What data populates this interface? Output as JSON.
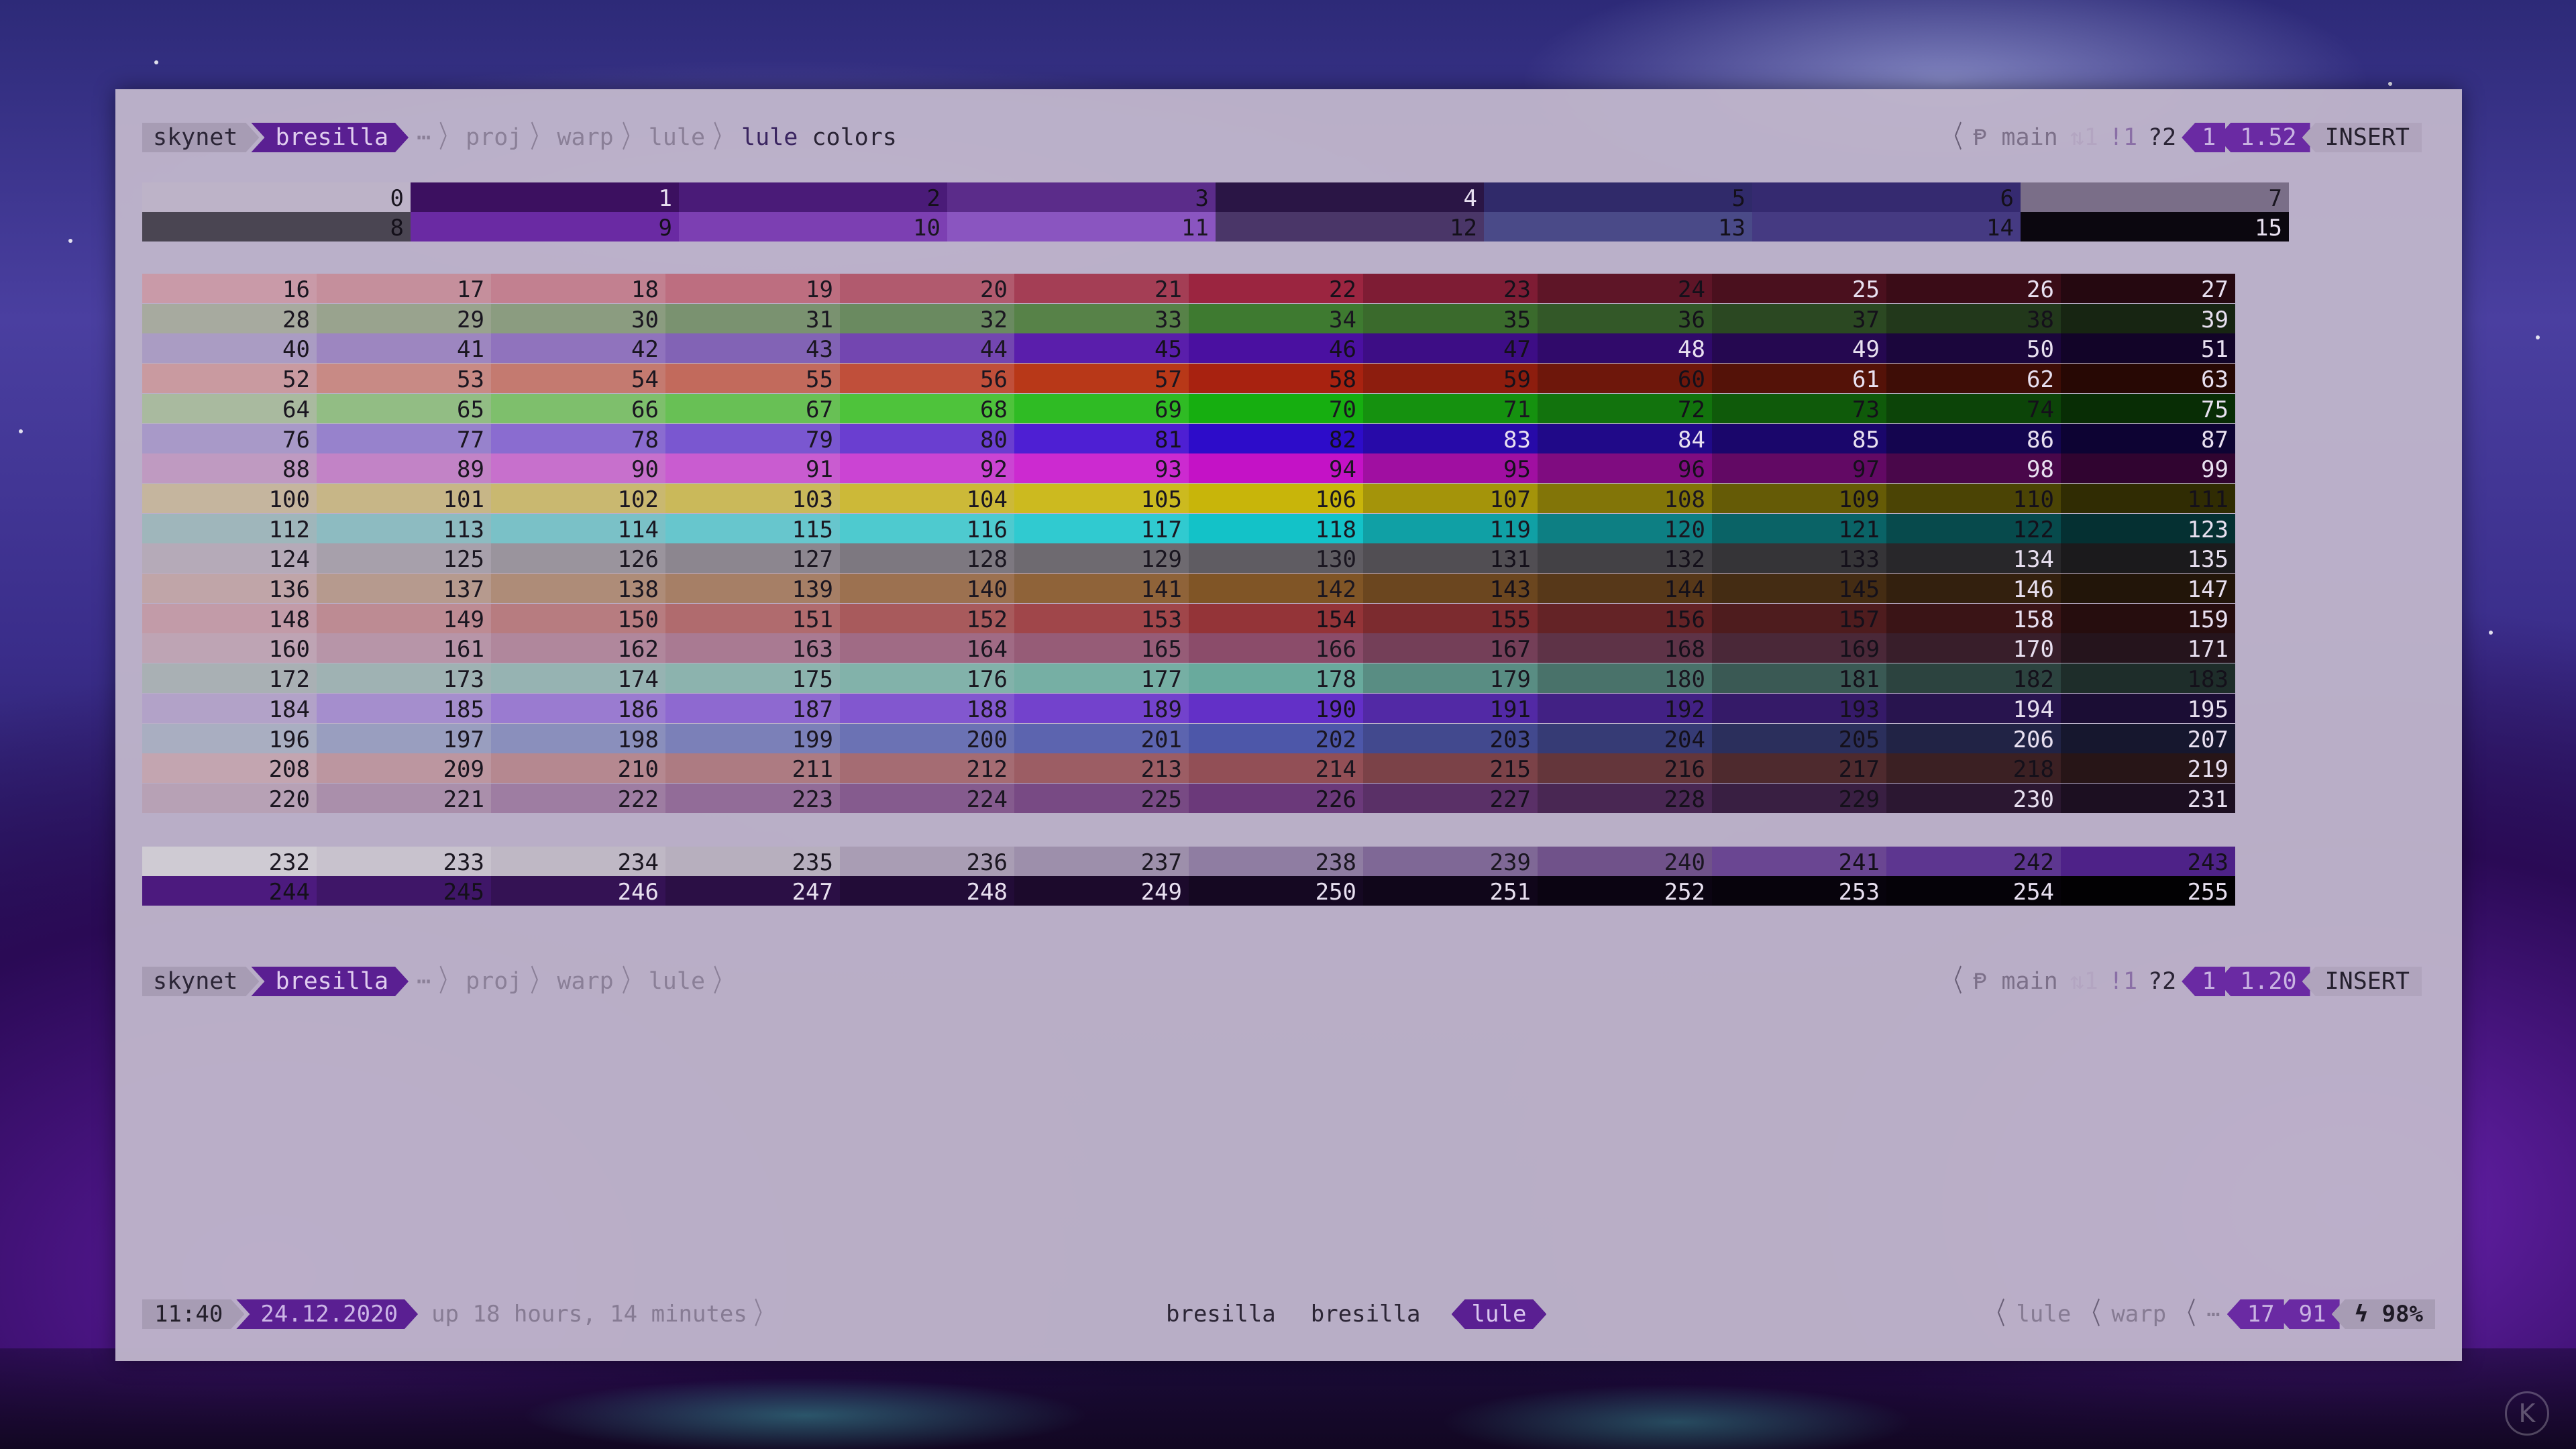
{
  "prompt_top": {
    "host": "skynet",
    "user": "bresilla",
    "ellipsis": "⋯",
    "path": [
      "proj",
      "warp",
      "lule"
    ],
    "command": "lule",
    "command_arg": "colors",
    "branch_icon": "Ᵽ",
    "branch": "main",
    "sync": "⇅1",
    "stash": "!1",
    "untracked": "?2",
    "jobs": "1",
    "duration": "1.52",
    "mode": "INSERT"
  },
  "prompt_bottom": {
    "host": "skynet",
    "user": "bresilla",
    "ellipsis": "⋯",
    "path": [
      "proj",
      "warp",
      "lule"
    ],
    "branch_icon": "Ᵽ",
    "branch": "main",
    "sync": "⇅1",
    "stash": "!1",
    "untracked": "?2",
    "jobs": "1",
    "duration": "1.20",
    "mode": "INSERT"
  },
  "palette": {
    "base_colors": [
      "#bdb3c8",
      "#3c1060",
      "#4a1b78",
      "#5b2c8a",
      "#2a1545",
      "#302a6a",
      "#352a70",
      "#7a6e88",
      "#4a4552",
      "#6a2aa3",
      "#7c3fb2",
      "#8a55c0",
      "#4a3668",
      "#4a4a88",
      "#453a82",
      "#0b070f"
    ],
    "cube_rows": [
      [
        "#c99aa8",
        "#c58f9c",
        "#c28090",
        "#bd6e80",
        "#b15a6e",
        "#a43e55",
        "#9b2540",
        "#7e1c34",
        "#5e1527",
        "#4a101e",
        "#3a0c17",
        "#250810"
      ],
      [
        "#a7aa9f",
        "#99a38e",
        "#8b9c80",
        "#7a9270",
        "#6a8a60",
        "#578248",
        "#3e7a30",
        "#3a6a2c",
        "#335828",
        "#2b4822",
        "#22381b",
        "#172512"
      ],
      [
        "#aa9cc3",
        "#9d86c0",
        "#9073bd",
        "#8263b5",
        "#7346b0",
        "#5a1eab",
        "#4a10a0",
        "#3d0d85",
        "#300a6a",
        "#250850",
        "#1b063c",
        "#120428"
      ],
      [
        "#c99aa0",
        "#c88a85",
        "#c47a70",
        "#c26a5c",
        "#c04f3a",
        "#b83818",
        "#a82210",
        "#8d1d0e",
        "#6e170b",
        "#541208",
        "#3e0d06",
        "#270804"
      ],
      [
        "#a9ba9f",
        "#92bd84",
        "#7ebf6c",
        "#68c055",
        "#4ec33b",
        "#2fbb24",
        "#16ae10",
        "#15910f",
        "#12730d",
        "#0f5a0a",
        "#0c4408",
        "#082d05"
      ],
      [
        "#a899c8",
        "#9782cc",
        "#8a6cd0",
        "#7a57d0",
        "#6a3ed0",
        "#4e1fd3",
        "#2d0cc9",
        "#270aa8",
        "#200988",
        "#1a066b",
        "#14054f",
        "#0d0333"
      ],
      [
        "#bf9ac1",
        "#c283c6",
        "#c770cc",
        "#c95cd0",
        "#cb44d3",
        "#cc2ad0",
        "#c412c6",
        "#a00fa1",
        "#7f0c80",
        "#620964",
        "#49074a",
        "#300430"
      ],
      [
        "#c5b59e",
        "#c7b687",
        "#c9b870",
        "#cab95a",
        "#ccb938",
        "#ccba1f",
        "#c8b50a",
        "#a4940a",
        "#827508",
        "#655b06",
        "#4b4405",
        "#302c03"
      ],
      [
        "#9fb6bb",
        "#8dbbc1",
        "#7ac1c7",
        "#67c6cd",
        "#4ecacf",
        "#30cad0",
        "#13c2c8",
        "#10a0a5",
        "#0d7f83",
        "#0a6366",
        "#074a4c",
        "#053032"
      ],
      [
        "#b5aab8",
        "#a7a0ab",
        "#9a949d",
        "#8c868f",
        "#7d7880",
        "#6e6a70",
        "#5f5c62",
        "#514e53",
        "#434145",
        "#353437",
        "#28272a",
        "#1b1a1c"
      ],
      [
        "#c0a5a8",
        "#b69a8e",
        "#ae8c78",
        "#a67f66",
        "#9c7150",
        "#8f6339",
        "#805526",
        "#6b461f",
        "#573819",
        "#442c13",
        "#33200e",
        "#221509"
      ],
      [
        "#c29ba8",
        "#bd8b93",
        "#b77c80",
        "#b06b6e",
        "#a85a5c",
        "#a0464a",
        "#943438",
        "#7c2b2f",
        "#642326",
        "#4e1c1e",
        "#3a1416",
        "#260d0e"
      ],
      [
        "#bea4b4",
        "#b795a8",
        "#b0879c",
        "#a97a92",
        "#a06b85",
        "#965c77",
        "#8b4c6a",
        "#743f58",
        "#5e3347",
        "#4a2838",
        "#381e2a",
        "#25141c"
      ],
      [
        "#a9b0b4",
        "#9fb2b3",
        "#96b3b2",
        "#8cb3ae",
        "#82b2aa",
        "#76afa4",
        "#69aa9d",
        "#598d83",
        "#49726a",
        "#3a5954",
        "#2c433f",
        "#1e2d2a"
      ],
      [
        "#b2a2c8",
        "#a58ecd",
        "#9a7bd0",
        "#8e69d0",
        "#8257cf",
        "#7342cc",
        "#6330c7",
        "#5229a5",
        "#422184",
        "#351a68",
        "#28144e",
        "#1b0d34"
      ],
      [
        "#a9aec1",
        "#999ebf",
        "#8a8fbc",
        "#7b80b8",
        "#6b72b4",
        "#5c64af",
        "#4d57a9",
        "#42498e",
        "#363b75",
        "#2b2f5c",
        "#212345",
        "#16172e"
      ],
      [
        "#c3a5b0",
        "#bc96a0",
        "#b58890",
        "#ad7b82",
        "#a56c73",
        "#9c5d64",
        "#924f56",
        "#7b4248",
        "#64363b",
        "#4e2a2e",
        "#3b2023",
        "#271517"
      ],
      [
        "#b7a1b5",
        "#aa8fab",
        "#9e7da2",
        "#926c98",
        "#855b8e",
        "#784a84",
        "#6b397a",
        "#5a3067",
        "#492753",
        "#391f42",
        "#2b1731",
        "#1c0f21"
      ]
    ],
    "gray_rows": [
      [
        "#cfcbd3",
        "#c8c2cd",
        "#bfb8c5",
        "#b7afbe",
        "#a99db4",
        "#9d8fab",
        "#8f7da2",
        "#7f6896",
        "#70528a",
        "#6a4692",
        "#5d3690",
        "#4e2288"
      ],
      [
        "#4c1a7e",
        "#3f1668",
        "#341254",
        "#2b0f45",
        "#220c37",
        "#1c0a2c",
        "#150822",
        "#10061a",
        "#0b0412",
        "#07030c",
        "#050208",
        "#020103"
      ]
    ]
  }
}
